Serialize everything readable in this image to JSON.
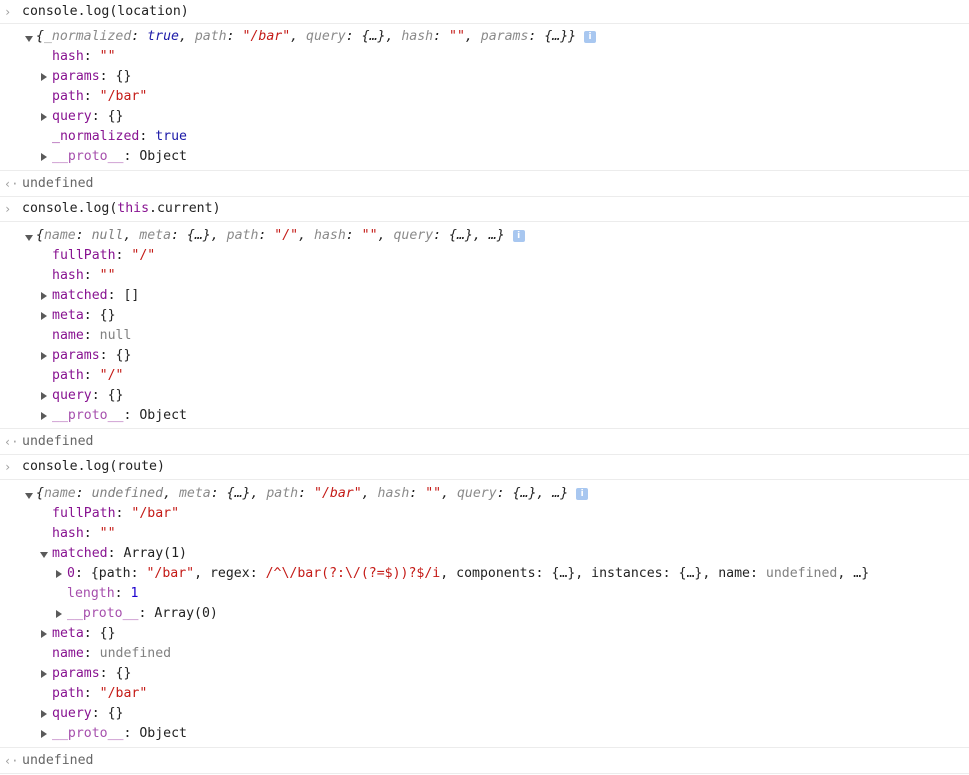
{
  "log1": {
    "command": "console.log(location)",
    "preview": {
      "k1": "_normalized",
      "v1": "true",
      "k2": "path",
      "v2": "\"/bar\"",
      "k3": "query",
      "v3": "{…}",
      "k4": "hash",
      "v4": "\"\"",
      "k5": "params",
      "v5": "{…}"
    },
    "props": {
      "hash_k": "hash",
      "hash_v": "\"\"",
      "params_k": "params",
      "params_v": "{}",
      "path_k": "path",
      "path_v": "\"/bar\"",
      "query_k": "query",
      "query_v": "{}",
      "norm_k": "_normalized",
      "norm_v": "true",
      "proto_k": "__proto__",
      "proto_v": "Object"
    },
    "result": "undefined"
  },
  "log2": {
    "command_prefix": "console.log(",
    "command_this": "this",
    "command_suffix": ".current)",
    "preview": {
      "k1": "name",
      "v1": "null",
      "k2": "meta",
      "v2": "{…}",
      "k3": "path",
      "v3": "\"/\"",
      "k4": "hash",
      "v4": "\"\"",
      "k5": "query",
      "v5": "{…}",
      "more": "…"
    },
    "props": {
      "fullPath_k": "fullPath",
      "fullPath_v": "\"/\"",
      "hash_k": "hash",
      "hash_v": "\"\"",
      "matched_k": "matched",
      "matched_v": "[]",
      "meta_k": "meta",
      "meta_v": "{}",
      "name_k": "name",
      "name_v": "null",
      "params_k": "params",
      "params_v": "{}",
      "path_k": "path",
      "path_v": "\"/\"",
      "query_k": "query",
      "query_v": "{}",
      "proto_k": "__proto__",
      "proto_v": "Object"
    },
    "result": "undefined"
  },
  "log3": {
    "command": "console.log(route)",
    "preview": {
      "k1": "name",
      "v1": "undefined",
      "k2": "meta",
      "v2": "{…}",
      "k3": "path",
      "v3": "\"/bar\"",
      "k4": "hash",
      "v4": "\"\"",
      "k5": "query",
      "v5": "{…}",
      "more": "…"
    },
    "props": {
      "fullPath_k": "fullPath",
      "fullPath_v": "\"/bar\"",
      "hash_k": "hash",
      "hash_v": "\"\"",
      "matched_k": "matched",
      "matched_v": "Array(1)",
      "item0": {
        "idx": "0",
        "k1": "path",
        "v1": "\"/bar\"",
        "k2": "regex",
        "v2": "/^\\/bar(?:\\/(?=$))?$/i",
        "k3": "components",
        "v3": "{…}",
        "k4": "instances",
        "v4": "{…}",
        "k5": "name",
        "v5": "undefined",
        "more": "…"
      },
      "length_k": "length",
      "length_v": "1",
      "aproto_k": "__proto__",
      "aproto_v": "Array(0)",
      "meta_k": "meta",
      "meta_v": "{}",
      "name_k": "name",
      "name_v": "undefined",
      "params_k": "params",
      "params_v": "{}",
      "path_k": "path",
      "path_v": "\"/bar\"",
      "query_k": "query",
      "query_v": "{}",
      "proto_k": "__proto__",
      "proto_v": "Object"
    },
    "result": "undefined"
  },
  "icons": {
    "prompt": "chevron-right-icon",
    "result": "return-arrow-icon",
    "info": "info-icon"
  }
}
